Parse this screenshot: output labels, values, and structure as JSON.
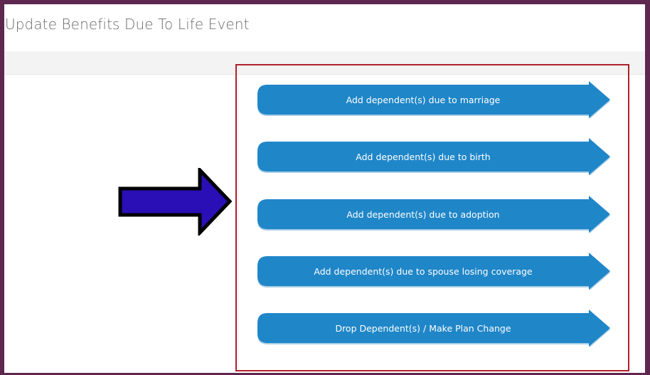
{
  "page": {
    "title": "Update Benefits Due To Life Event"
  },
  "colors": {
    "frame": "#5e2750",
    "button_fill": "#1f86c8",
    "button_shadow": "#a7cde6",
    "highlight_border": "#b0202a",
    "pointer_arrow_fill": "#2a0fb6",
    "title_text": "#6b6b6b"
  },
  "annotation": {
    "pointer_icon": "right-arrow-icon"
  },
  "life_events": [
    {
      "label": "Add dependent(s) due to marriage"
    },
    {
      "label": "Add dependent(s) due to birth"
    },
    {
      "label": "Add dependent(s) due to adoption"
    },
    {
      "label": "Add dependent(s) due to spouse losing coverage"
    },
    {
      "label": "Drop Dependent(s) / Make Plan Change"
    }
  ]
}
